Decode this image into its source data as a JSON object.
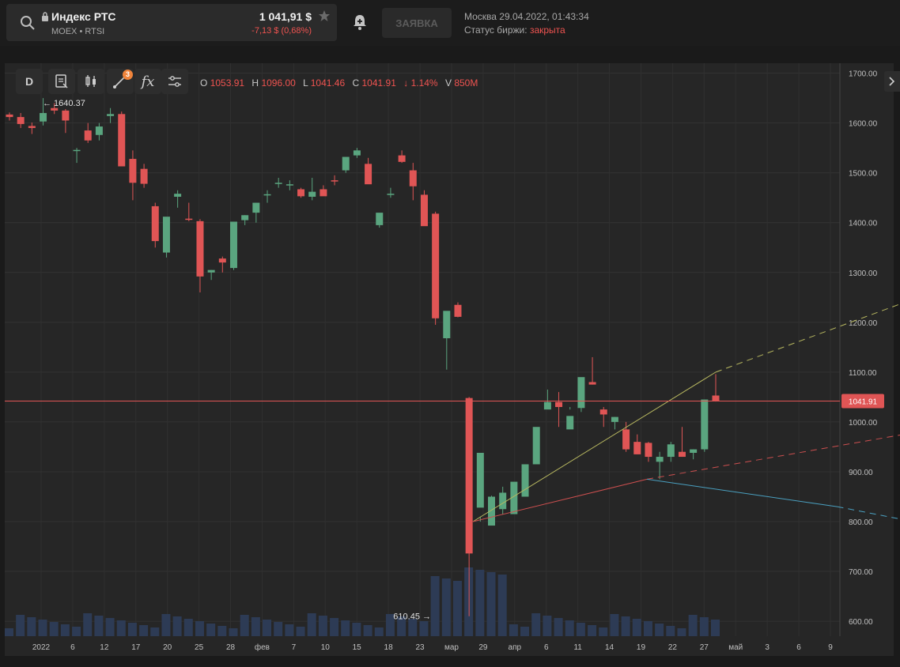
{
  "ticker": {
    "name": "Индекс РТС",
    "exchange": "MOEX",
    "code": "RTSI",
    "price": "1 041,91 $",
    "change": "-7,13 $ (0,68%)"
  },
  "actions": {
    "order_button": "ЗАЯВКА",
    "alert_icon": "bell-plus-icon"
  },
  "market": {
    "datetime": "Москва 29.04.2022, 01:43:34",
    "status_label": "Статус биржи:",
    "status_value": "закрыта"
  },
  "toolbar": {
    "interval": "D",
    "buttons": [
      "notes-icon",
      "candles-icon",
      "drawing-tools-icon",
      "indicators-icon",
      "settings-icon"
    ],
    "drawing_badge": "3",
    "indicators_label": "fx"
  },
  "ohlc": {
    "o_label": "O",
    "o": "1053.91",
    "h_label": "H",
    "h": "1096.00",
    "l_label": "L",
    "l": "1041.46",
    "c_label": "C",
    "c": "1041.91",
    "pct": "1.14%",
    "v_label": "V",
    "v": "850M"
  },
  "colors": {
    "up": "#5aa57f",
    "down": "#e05555",
    "last_price": "#e05555",
    "volume": "#2d3b55",
    "trend1": "#b8b860",
    "trend2": "#cc4f4f",
    "trend3": "#4aa0c0"
  },
  "chart_data": {
    "type": "candlestick",
    "ylim": [
      570,
      1720
    ],
    "yticks": [
      "1700.00",
      "1600.00",
      "1500.00",
      "1400.00",
      "1300.00",
      "1200.00",
      "1100.00",
      "1000.00",
      "900.00",
      "800.00",
      "700.00",
      "600.00"
    ],
    "xticks": [
      "2022",
      "6",
      "12",
      "17",
      "20",
      "25",
      "28",
      "фев",
      "7",
      "10",
      "15",
      "18",
      "23",
      "мар",
      "29",
      "апр",
      "6",
      "11",
      "14",
      "19",
      "22",
      "27",
      "май",
      "3",
      "6",
      "9"
    ],
    "last_price": 1041.91,
    "last_price_label": "1041.91",
    "annotations": [
      {
        "text": "← 1640.37",
        "value": 1640.37
      },
      {
        "text": "610.45 →",
        "value": 610.45
      }
    ],
    "candles": [
      [
        1617,
        1621,
        1605,
        1612
      ],
      [
        1612,
        1620,
        1590,
        1598
      ],
      [
        1594,
        1601,
        1578,
        1590
      ],
      [
        1603,
        1650,
        1595,
        1620
      ],
      [
        1630,
        1640,
        1618,
        1625
      ],
      [
        1625,
        1628,
        1580,
        1605
      ],
      [
        1545,
        1550,
        1520,
        1546
      ],
      [
        1585,
        1600,
        1560,
        1565
      ],
      [
        1576,
        1600,
        1565,
        1593
      ],
      [
        1614,
        1630,
        1600,
        1618
      ],
      [
        1618,
        1623,
        1515,
        1513
      ],
      [
        1528,
        1545,
        1445,
        1480
      ],
      [
        1508,
        1518,
        1470,
        1478
      ],
      [
        1433,
        1440,
        1350,
        1363
      ],
      [
        1340,
        1345,
        1330,
        1412
      ],
      [
        1452,
        1465,
        1430,
        1458
      ],
      [
        1408,
        1440,
        1403,
        1407
      ],
      [
        1403,
        1407,
        1260,
        1292
      ],
      [
        1300,
        1305,
        1285,
        1305
      ],
      [
        1328,
        1332,
        1300,
        1320
      ],
      [
        1309,
        1375,
        1305,
        1402
      ],
      [
        1405,
        1415,
        1395,
        1415
      ],
      [
        1420,
        1440,
        1400,
        1440
      ],
      [
        1455,
        1465,
        1440,
        1457
      ],
      [
        1480,
        1490,
        1470,
        1480
      ],
      [
        1475,
        1485,
        1465,
        1477
      ],
      [
        1467,
        1470,
        1450,
        1453
      ],
      [
        1452,
        1490,
        1445,
        1462
      ],
      [
        1467,
        1475,
        1455,
        1453
      ],
      [
        1485,
        1495,
        1475,
        1483
      ],
      [
        1505,
        1515,
        1500,
        1532
      ],
      [
        1535,
        1550,
        1530,
        1545
      ],
      [
        1518,
        1530,
        1505,
        1477
      ],
      [
        1395,
        1410,
        1390,
        1420
      ],
      [
        1458,
        1470,
        1450,
        1458
      ],
      [
        1535,
        1545,
        1520,
        1522
      ],
      [
        1505,
        1520,
        1445,
        1473
      ],
      [
        1456,
        1465,
        1395,
        1393
      ],
      [
        1418,
        1422,
        1195,
        1208
      ],
      [
        1168,
        1175,
        1105,
        1223
      ],
      [
        1235,
        1240,
        1210,
        1211
      ],
      [
        1048,
        1050,
        610,
        736
      ],
      [
        828,
        810,
        800,
        938
      ],
      [
        792,
        852,
        800,
        850
      ],
      [
        825,
        870,
        815,
        858
      ],
      [
        815,
        860,
        870,
        880
      ],
      [
        850,
        890,
        913,
        915
      ],
      [
        915,
        920,
        965,
        990
      ],
      [
        1025,
        1065,
        1030,
        1040
      ],
      [
        1040,
        1060,
        990,
        1030
      ],
      [
        985,
        1030,
        1025,
        1012
      ],
      [
        1028,
        1085,
        1020,
        1090
      ],
      [
        1080,
        1130,
        1075,
        1075
      ],
      [
        1025,
        1030,
        990,
        1015
      ],
      [
        1000,
        1010,
        985,
        1010
      ],
      [
        985,
        1000,
        940,
        945
      ],
      [
        960,
        975,
        935,
        935
      ],
      [
        958,
        960,
        920,
        930
      ],
      [
        920,
        940,
        885,
        930
      ],
      [
        930,
        960,
        920,
        955
      ],
      [
        940,
        990,
        930,
        930
      ],
      [
        938,
        945,
        925,
        945
      ],
      [
        945,
        1015,
        940,
        1045
      ],
      [
        1053,
        1096,
        1041,
        1042
      ]
    ],
    "trendlines": [
      {
        "from": [
          1,
          800
        ],
        "to": [
          7,
          1100
        ],
        "extend": [
          12,
          1250
        ],
        "color_key": "trend1"
      },
      {
        "from": [
          1,
          800
        ],
        "to": [
          5.3,
          885
        ],
        "extend": [
          12,
          980
        ],
        "color_key": "trend2"
      },
      {
        "from": [
          5.3,
          885
        ],
        "to": [
          10,
          830
        ],
        "extend": [
          12,
          798
        ],
        "color_key": "trend3"
      }
    ]
  }
}
